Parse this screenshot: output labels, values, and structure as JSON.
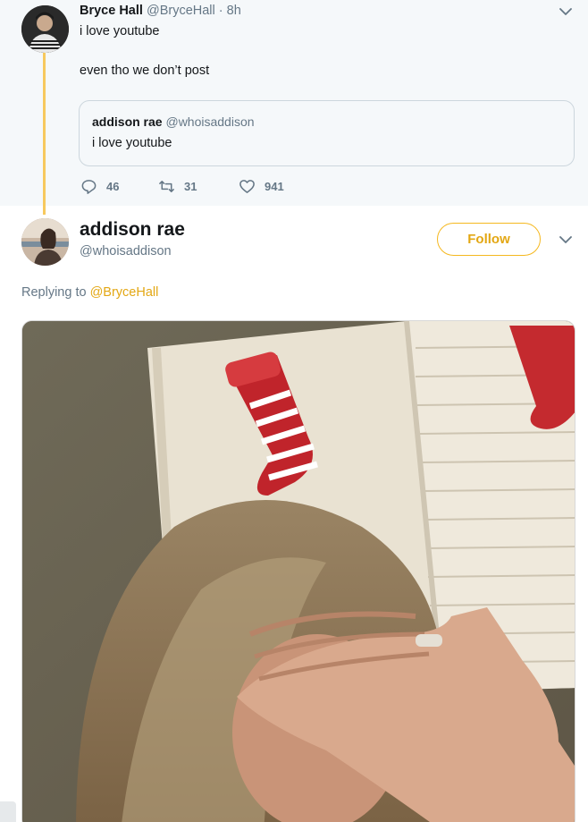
{
  "colors": {
    "accent": "#e3a713",
    "thread_line": "#f7c95e",
    "secondary_text": "#657786",
    "parent_background": "#f5f8fa"
  },
  "parent_tweet": {
    "author_name": "Bryce Hall",
    "author_handle": "@BryceHall",
    "separator": "·",
    "time": "8h",
    "text_line1": "i love youtube",
    "text_line2": "even tho we don’t post",
    "quoted_tweet": {
      "author_name": "addison rae",
      "author_handle": "@whoisaddison",
      "text": "i love youtube"
    },
    "actions": {
      "reply_count": "46",
      "retweet_count": "31",
      "like_count": "941"
    },
    "icons": [
      "avatar",
      "chevron-down-icon",
      "reply-icon",
      "retweet-icon",
      "heart-icon"
    ]
  },
  "main_tweet": {
    "author_name": "addison rae",
    "author_handle": "@whoisaddison",
    "follow_label": "Follow",
    "replying_prefix": "Replying to",
    "replying_handle": "@BryceHall",
    "photo_description_icon": "photo"
  }
}
